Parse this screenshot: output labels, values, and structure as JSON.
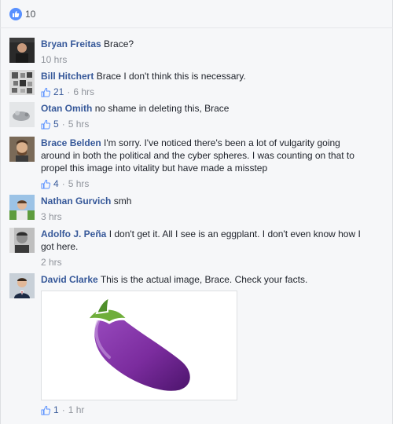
{
  "like_summary": {
    "count": "10"
  },
  "comments": [
    {
      "author": "Bryan Freitas",
      "text": "Brace?",
      "time": "10 hrs",
      "likes": ""
    },
    {
      "author": "Bill Hitchert",
      "text": "Brace I don't think this is necessary.",
      "time": "6 hrs",
      "likes": "21"
    },
    {
      "author": "Otan Omith",
      "text": "no shame in deleting this, Brace",
      "time": "5 hrs",
      "likes": "5"
    },
    {
      "author": "Brace Belden",
      "text": "I'm sorry. I've noticed there's been a lot of vulgarity going around in both the political and the cyber spheres. I was counting on that to propel this image into vitality but have made a misstep",
      "time": "5 hrs",
      "likes": "4"
    },
    {
      "author": "Nathan Gurvich",
      "text": "smh",
      "time": "3 hrs",
      "likes": ""
    },
    {
      "author": "Adolfo J. Peña",
      "text": "I don't get it. All I see is an eggplant. I don't even know how I got here.",
      "time": "2 hrs",
      "likes": ""
    },
    {
      "author": "David Clarke",
      "text": "This is the actual image, Brace. Check your facts.",
      "time": "1 hr",
      "likes": "1"
    }
  ],
  "colors": {
    "link": "#365899",
    "meta": "#90949c",
    "like_badge": "#5890ff",
    "eggplant": "#7b2c9e",
    "stem": "#6fae3a"
  }
}
